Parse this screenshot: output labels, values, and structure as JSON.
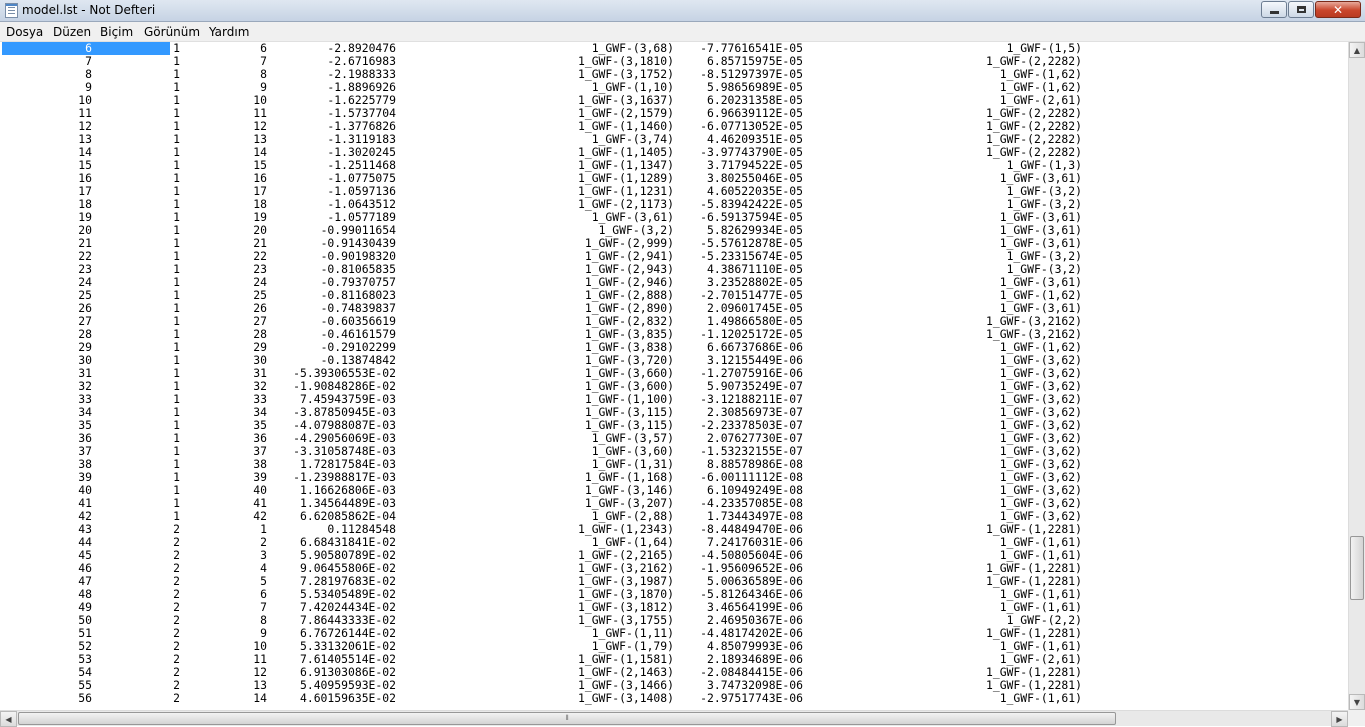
{
  "window": {
    "title": "model.lst - Not Defteri",
    "minimize_glyph": "",
    "close_glyph": "✕"
  },
  "menu": [
    "Dosya",
    "Düzen",
    "Biçim",
    "Görünüm",
    "Yardım"
  ],
  "rows": [
    [
      "6",
      "1",
      "6",
      "-2.8920476",
      "1_GWF-(3,68)",
      "-7.77616541E-05",
      "1_GWF-(1,5)"
    ],
    [
      "7",
      "1",
      "7",
      "-2.6716983",
      "1_GWF-(3,1810)",
      "6.85715975E-05",
      "1_GWF-(2,2282)"
    ],
    [
      "8",
      "1",
      "8",
      "-2.1988333",
      "1_GWF-(3,1752)",
      "-8.51297397E-05",
      "1_GWF-(1,62)"
    ],
    [
      "9",
      "1",
      "9",
      "-1.8896926",
      "1_GWF-(1,10)",
      "5.98656989E-05",
      "1_GWF-(1,62)"
    ],
    [
      "10",
      "1",
      "10",
      "-1.6225779",
      "1_GWF-(3,1637)",
      "6.20231358E-05",
      "1_GWF-(2,61)"
    ],
    [
      "11",
      "1",
      "11",
      "-1.5737704",
      "1_GWF-(2,1579)",
      "6.96639112E-05",
      "1_GWF-(2,2282)"
    ],
    [
      "12",
      "1",
      "12",
      "-1.3776826",
      "1_GWF-(1,1460)",
      "-6.07713052E-05",
      "1_GWF-(2,2282)"
    ],
    [
      "13",
      "1",
      "13",
      "-1.3119183",
      "1_GWF-(3,74)",
      "4.46209351E-05",
      "1_GWF-(2,2282)"
    ],
    [
      "14",
      "1",
      "14",
      "-1.3020245",
      "1_GWF-(1,1405)",
      "-3.97743790E-05",
      "1_GWF-(2,2282)"
    ],
    [
      "15",
      "1",
      "15",
      "-1.2511468",
      "1_GWF-(1,1347)",
      "3.71794522E-05",
      "1_GWF-(1,3)"
    ],
    [
      "16",
      "1",
      "16",
      "-1.0775075",
      "1_GWF-(1,1289)",
      "3.80255046E-05",
      "1_GWF-(3,61)"
    ],
    [
      "17",
      "1",
      "17",
      "-1.0597136",
      "1_GWF-(1,1231)",
      "4.60522035E-05",
      "1_GWF-(3,2)"
    ],
    [
      "18",
      "1",
      "18",
      "-1.0643512",
      "1_GWF-(2,1173)",
      "-5.83942422E-05",
      "1_GWF-(3,2)"
    ],
    [
      "19",
      "1",
      "19",
      "-1.0577189",
      "1_GWF-(3,61)",
      "-6.59137594E-05",
      "1_GWF-(3,61)"
    ],
    [
      "20",
      "1",
      "20",
      "-0.99011654",
      "1_GWF-(3,2)",
      "5.82629934E-05",
      "1_GWF-(3,61)"
    ],
    [
      "21",
      "1",
      "21",
      "-0.91430439",
      "1_GWF-(2,999)",
      "-5.57612878E-05",
      "1_GWF-(3,61)"
    ],
    [
      "22",
      "1",
      "22",
      "-0.90198320",
      "1_GWF-(2,941)",
      "-5.23315674E-05",
      "1_GWF-(3,2)"
    ],
    [
      "23",
      "1",
      "23",
      "-0.81065835",
      "1_GWF-(2,943)",
      "4.38671110E-05",
      "1_GWF-(3,2)"
    ],
    [
      "24",
      "1",
      "24",
      "-0.79370757",
      "1_GWF-(2,946)",
      "3.23528802E-05",
      "1_GWF-(3,61)"
    ],
    [
      "25",
      "1",
      "25",
      "-0.81168023",
      "1_GWF-(2,888)",
      "-2.70151477E-05",
      "1_GWF-(1,62)"
    ],
    [
      "26",
      "1",
      "26",
      "-0.74839837",
      "1_GWF-(2,890)",
      "2.09601745E-05",
      "1_GWF-(3,61)"
    ],
    [
      "27",
      "1",
      "27",
      "-0.60356619",
      "1_GWF-(2,832)",
      "1.49866580E-05",
      "1_GWF-(3,2162)"
    ],
    [
      "28",
      "1",
      "28",
      "-0.46161579",
      "1_GWF-(3,835)",
      "-1.12025172E-05",
      "1_GWF-(3,2162)"
    ],
    [
      "29",
      "1",
      "29",
      "-0.29102299",
      "1_GWF-(3,838)",
      "6.66737686E-06",
      "1_GWF-(1,62)"
    ],
    [
      "30",
      "1",
      "30",
      "-0.13874842",
      "1_GWF-(3,720)",
      "3.12155449E-06",
      "1_GWF-(3,62)"
    ],
    [
      "31",
      "1",
      "31",
      "-5.39306553E-02",
      "1_GWF-(3,660)",
      "-1.27075916E-06",
      "1_GWF-(3,62)"
    ],
    [
      "32",
      "1",
      "32",
      "-1.90848286E-02",
      "1_GWF-(3,600)",
      "5.90735249E-07",
      "1_GWF-(3,62)"
    ],
    [
      "33",
      "1",
      "33",
      "7.45943759E-03",
      "1_GWF-(1,100)",
      "-3.12188211E-07",
      "1_GWF-(3,62)"
    ],
    [
      "34",
      "1",
      "34",
      "-3.87850945E-03",
      "1_GWF-(3,115)",
      "2.30856973E-07",
      "1_GWF-(3,62)"
    ],
    [
      "35",
      "1",
      "35",
      "-4.07988087E-03",
      "1_GWF-(3,115)",
      "-2.23378503E-07",
      "1_GWF-(3,62)"
    ],
    [
      "36",
      "1",
      "36",
      "-4.29056069E-03",
      "1_GWF-(3,57)",
      "2.07627730E-07",
      "1_GWF-(3,62)"
    ],
    [
      "37",
      "1",
      "37",
      "-3.31058748E-03",
      "1_GWF-(3,60)",
      "-1.53232155E-07",
      "1_GWF-(3,62)"
    ],
    [
      "38",
      "1",
      "38",
      "1.72817584E-03",
      "1_GWF-(1,31)",
      "8.88578986E-08",
      "1_GWF-(3,62)"
    ],
    [
      "39",
      "1",
      "39",
      "-1.23988817E-03",
      "1_GWF-(1,168)",
      "-6.00111112E-08",
      "1_GWF-(3,62)"
    ],
    [
      "40",
      "1",
      "40",
      "1.16626806E-03",
      "1_GWF-(3,146)",
      "6.10949249E-08",
      "1_GWF-(3,62)"
    ],
    [
      "41",
      "1",
      "41",
      "1.34564489E-03",
      "1_GWF-(3,207)",
      "-4.23357085E-08",
      "1_GWF-(3,62)"
    ],
    [
      "42",
      "1",
      "42",
      "6.62085862E-04",
      "1_GWF-(2,88)",
      "1.73443497E-08",
      "1_GWF-(3,62)"
    ],
    [
      "43",
      "2",
      "1",
      "0.11284548",
      "1_GWF-(1,2343)",
      "-8.44849470E-06",
      "1_GWF-(1,2281)"
    ],
    [
      "44",
      "2",
      "2",
      "6.68431841E-02",
      "1_GWF-(1,64)",
      "7.24176031E-06",
      "1_GWF-(1,61)"
    ],
    [
      "45",
      "2",
      "3",
      "5.90580789E-02",
      "1_GWF-(2,2165)",
      "-4.50805604E-06",
      "1_GWF-(1,61)"
    ],
    [
      "46",
      "2",
      "4",
      "9.06455806E-02",
      "1_GWF-(3,2162)",
      "-1.95609652E-06",
      "1_GWF-(1,2281)"
    ],
    [
      "47",
      "2",
      "5",
      "7.28197683E-02",
      "1_GWF-(3,1987)",
      "5.00636589E-06",
      "1_GWF-(1,2281)"
    ],
    [
      "48",
      "2",
      "6",
      "5.53405489E-02",
      "1_GWF-(3,1870)",
      "-5.81264346E-06",
      "1_GWF-(1,61)"
    ],
    [
      "49",
      "2",
      "7",
      "7.42024434E-02",
      "1_GWF-(3,1812)",
      "3.46564199E-06",
      "1_GWF-(1,61)"
    ],
    [
      "50",
      "2",
      "8",
      "7.86443333E-02",
      "1_GWF-(3,1755)",
      "2.46950367E-06",
      "1_GWF-(2,2)"
    ],
    [
      "51",
      "2",
      "9",
      "6.76726144E-02",
      "1_GWF-(1,11)",
      "-4.48174202E-06",
      "1_GWF-(1,2281)"
    ],
    [
      "52",
      "2",
      "10",
      "5.33132061E-02",
      "1_GWF-(1,79)",
      "4.85079993E-06",
      "1_GWF-(1,61)"
    ],
    [
      "53",
      "2",
      "11",
      "7.61405514E-02",
      "1_GWF-(1,1581)",
      "2.18934689E-06",
      "1_GWF-(2,61)"
    ],
    [
      "54",
      "2",
      "12",
      "6.91303086E-02",
      "1_GWF-(2,1463)",
      "-2.08484415E-06",
      "1_GWF-(1,2281)"
    ],
    [
      "55",
      "2",
      "13",
      "5.40959593E-02",
      "1_GWF-(3,1466)",
      "3.74732098E-06",
      "1_GWF-(1,2281)"
    ],
    [
      "56",
      "2",
      "14",
      "4.60159635E-02",
      "1_GWF-(3,1408)",
      "-2.97517743E-06",
      "1_GWF-(1,61)"
    ]
  ],
  "scroll": {
    "vertical_position": 0.77,
    "horizontal_thumb_grip": "⦀"
  }
}
